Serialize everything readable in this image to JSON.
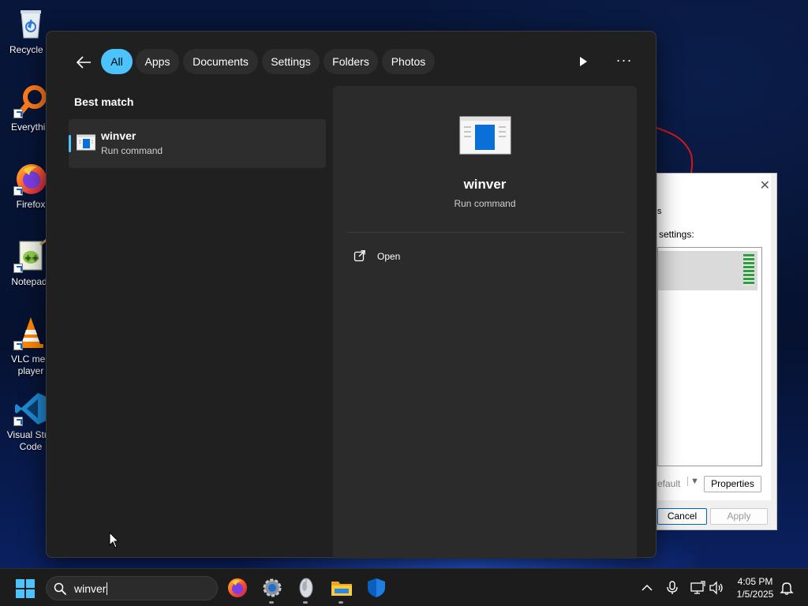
{
  "desktop": {
    "icons": [
      {
        "label": "Recycle B",
        "icon": "recycle-bin-icon"
      },
      {
        "label": "Everythin",
        "icon": "everything-search-icon"
      },
      {
        "label": "Firefox",
        "icon": "firefox-icon"
      },
      {
        "label": "Notepad-",
        "icon": "notepad-plus-plus-icon"
      },
      {
        "label": "VLC med\nplayer",
        "icon": "vlc-cone-icon"
      },
      {
        "label": "Visual Stud\nCode",
        "icon": "vscode-icon"
      }
    ]
  },
  "background_dialog": {
    "close": "✕",
    "tab_fragment": "s",
    "settings_label": "settings:",
    "default_label": "efault",
    "properties_label": "Properties",
    "cancel_label": "Cancel",
    "apply_label": "Apply"
  },
  "search": {
    "filters": [
      "All",
      "Apps",
      "Documents",
      "Settings",
      "Folders",
      "Photos"
    ],
    "active_filter": "All",
    "more_label": "···",
    "best_match_label": "Best match",
    "result": {
      "title": "winver",
      "subtitle": "Run command",
      "icon": "winver-app-icon"
    },
    "preview": {
      "title": "winver",
      "subtitle": "Run command",
      "actions": [
        {
          "label": "Open",
          "icon": "open-external-icon"
        }
      ]
    }
  },
  "taskbar": {
    "search_text": "winver",
    "pinned": [
      "firefox-icon",
      "settings-gear-icon",
      "mouse-app-icon",
      "file-explorer-icon",
      "windows-security-icon"
    ],
    "clock": {
      "time": "4:05 PM",
      "date": "1/5/2025"
    }
  },
  "colors": {
    "accent": "#4cc2ff",
    "panel_bg": "#202020",
    "preview_bg": "#2b2b2b",
    "taskbar_bg": "#1c1c1c"
  }
}
